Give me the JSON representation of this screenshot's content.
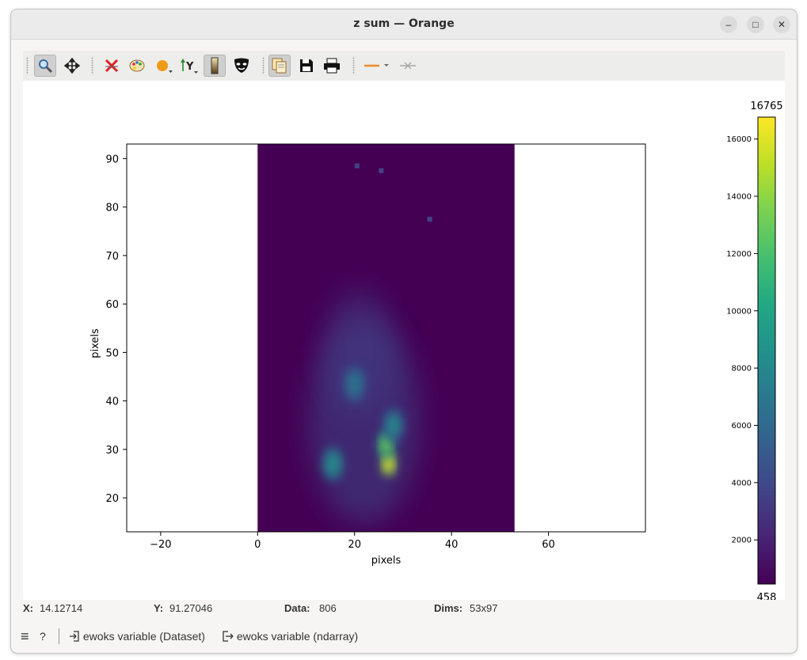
{
  "window": {
    "title": "z sum — Orange",
    "minimize": "–",
    "maximize": "□",
    "close": "✕"
  },
  "toolbar": {
    "items": [
      "zoom-icon",
      "pan-icon",
      "reset-zoom-icon",
      "colormap-icon",
      "curve-style-icon",
      "y-axis-icon",
      "colorbar-icon",
      "mask-icon",
      "copy-icon",
      "save-icon",
      "print-icon",
      "line-style-icon",
      "crosshair-icon"
    ]
  },
  "colors": {
    "viridis_low": "#440154",
    "viridis_high": "#fde725",
    "line_orange": "#f08c28"
  },
  "chart_data": {
    "type": "heatmap",
    "xlabel": "pixels",
    "ylabel": "pixels",
    "xlim": [
      -27,
      80
    ],
    "ylim": [
      13,
      93
    ],
    "xticks": [
      -20,
      0,
      20,
      40,
      60
    ],
    "yticks": [
      20,
      30,
      40,
      50,
      60,
      70,
      80,
      90
    ],
    "image_extent": {
      "x": [
        0,
        53
      ],
      "y": [
        13,
        93
      ]
    },
    "dims": "53x97",
    "colormap": "viridis",
    "colorbar": {
      "min": 458,
      "max": 16765,
      "ticks": [
        2000,
        4000,
        6000,
        8000,
        10000,
        12000,
        14000,
        16000
      ]
    },
    "hotspots": [
      {
        "x": 27,
        "y": 27,
        "value": 16765
      },
      {
        "x": 26.5,
        "y": 31,
        "value": 14000
      },
      {
        "x": 15.5,
        "y": 27,
        "value": 9000
      },
      {
        "x": 20,
        "y": 43.5,
        "value": 7000
      },
      {
        "x": 28,
        "y": 35,
        "value": 8000
      }
    ],
    "hot_pixels": [
      {
        "x": 20.5,
        "y": 88.5
      },
      {
        "x": 25.5,
        "y": 87.5
      },
      {
        "x": 35.5,
        "y": 77.5
      }
    ]
  },
  "status": {
    "x_label": "X:",
    "x_value": "14.12714",
    "y_label": "Y:",
    "y_value": "91.27046",
    "data_label": "Data:",
    "data_value": "806",
    "dims_label": "Dims:",
    "dims_value": "53x97"
  },
  "bottombar": {
    "menu_icon": "≡",
    "help_icon": "?",
    "input_label": "ewoks variable (Dataset)",
    "output_label": "ewoks variable (ndarray)"
  }
}
